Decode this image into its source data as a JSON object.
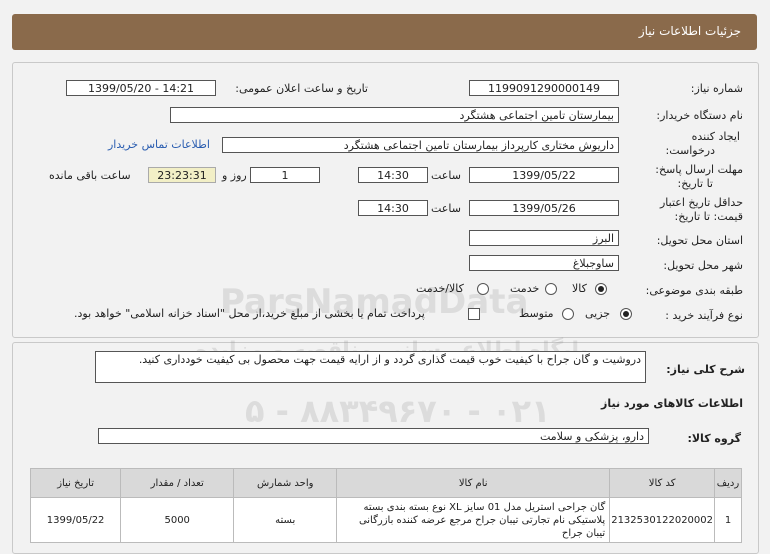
{
  "header": {
    "title": "جزئیات اطلاعات نیاز"
  },
  "form": {
    "need_number_label": "شماره نیاز:",
    "need_number": "1199091290000149",
    "announce_label": "تاریخ و ساعت اعلان عمومی:",
    "announce_value": "1399/05/20 - 14:21",
    "buyer_label": "نام دستگاه خریدار:",
    "buyer_value": "بیمارستان تامین اجتماعی هشتگرد",
    "creator_label_1": "ایجاد کننده",
    "creator_label_2": "درخواست:",
    "creator_value": "داریوش مختاری کارپرداز بیمارستان تامین اجتماعی هشتگرد",
    "contact_link": "اطلاعات تماس خریدار",
    "send_deadline_label_1": "مهلت ارسال پاسخ:",
    "send_deadline_label_2": "تا تاریخ:",
    "send_date": "1399/05/22",
    "time_label": "ساعت",
    "send_time": "14:30",
    "days_value": "1",
    "days_label": "روز و",
    "remaining_time": "23:23:31",
    "remaining_label": "ساعت باقی مانده",
    "validity_label_1": "حداقل تاریخ اعتبار",
    "validity_label_2": "قیمت: تا تاریخ:",
    "validity_date": "1399/05/26",
    "validity_time_label": "ساعت",
    "validity_time": "14:30",
    "province_label": "استان محل تحویل:",
    "province_value": "البرز",
    "city_label": "شهر محل تحویل:",
    "city_value": "ساوجبلاغ",
    "category_label": "طبقه بندی موضوعی:",
    "category_options": [
      "کالا",
      "خدمت",
      "کالا/خدمت"
    ],
    "process_label": "نوع فرآیند خرید :",
    "process_options": [
      "جزیی",
      "متوسط"
    ],
    "payment_note": "پرداخت تمام یا بخشی از مبلغ خرید،از محل \"اسناد خزانه اسلامی\" خواهد بود."
  },
  "description": {
    "label": "شرح کلی نیاز:",
    "text": "دروشیت و گان جراح با کیفیت خوب قیمت گذاری گردد و از ارایه قیمت جهت محصول بی کیفیت خودداری کنید."
  },
  "goods": {
    "section_title": "اطلاعات کالاهای مورد نیاز",
    "group_label": "گروه کالا:",
    "group_value": "دارو، پزشکی و سلامت",
    "columns": [
      "ردیف",
      "کد کالا",
      "نام کالا",
      "واحد شمارش",
      "تعداد / مقدار",
      "تاریخ نیاز"
    ],
    "rows": [
      {
        "row": "1",
        "code": "2132530122020002",
        "name": "گان جراحی استریل مدل 01 سایز XL نوع بسته بندی بسته پلاستیکی نام تجارتی تیبان جراح مرجع عرضه کننده بازرگانی تیبان جراح",
        "unit": "بسته",
        "qty": "5000",
        "date": "1399/05/22"
      }
    ]
  },
  "watermark": {
    "line1": "ParsNamadData",
    "line2": "پایگاه اطلاع رسانی مناقصه و مزایده",
    "line3": "۰۲۱ - ۸۸۳۴۹۶۷۰ - ۵"
  }
}
